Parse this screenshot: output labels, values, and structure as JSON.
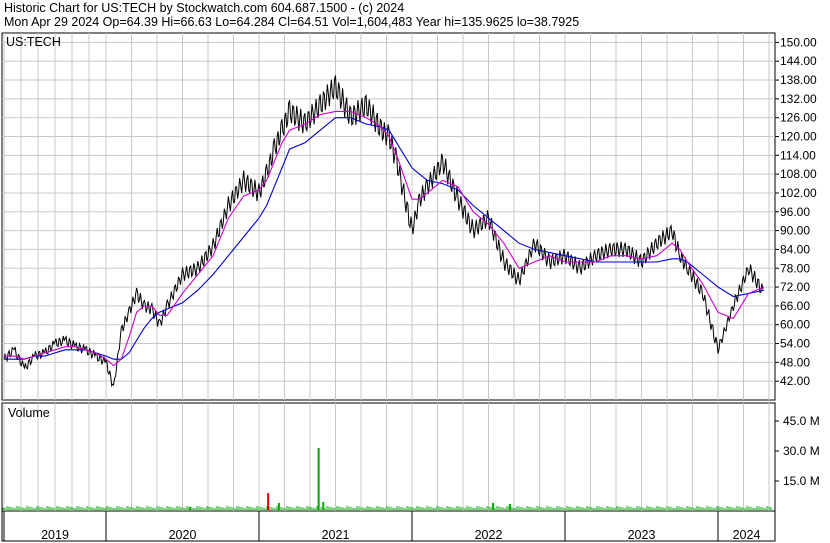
{
  "header": {
    "title_line": "Historic Chart for US:TECH by Stockwatch.com 604.687.1500 - (c) 2024",
    "stats_line": "Mon Apr 29 2024   Op=64.39   Hi=66.63   Lo=64.284   Cl=64.51   Vol=1,604,483   Year hi=135.9625   lo=38.7925"
  },
  "price_panel": {
    "symbol": "US:TECH"
  },
  "volume_panel": {
    "label": "Volume"
  },
  "colors": {
    "price": "#000000",
    "ma_short": "#cc00cc",
    "ma_long": "#0000cc",
    "vol_up": "#00aa00",
    "vol_down": "#dd0000",
    "grid": "#c8c8c8"
  },
  "chart_data": [
    {
      "type": "line",
      "title": "US:TECH",
      "ylim": [
        36,
        153
      ],
      "y_ticks": [
        "150.00",
        "144.00",
        "138.00",
        "132.00",
        "126.00",
        "120.00",
        "114.00",
        "108.00",
        "102.00",
        "96.00",
        "90.00",
        "84.00",
        "78.00",
        "72.00",
        "66.00",
        "60.00",
        "54.00",
        "48.00",
        "42.00"
      ],
      "x_ticks": [
        "2019",
        "2020",
        "2021",
        "2022",
        "2023",
        "2024"
      ],
      "x": [
        2019.0,
        2019.1,
        2019.2,
        2019.3,
        2019.4,
        2019.5,
        2019.6,
        2019.7,
        2019.8,
        2019.9,
        2020.0,
        2020.05,
        2020.1,
        2020.15,
        2020.2,
        2020.25,
        2020.3,
        2020.35,
        2020.4,
        2020.5,
        2020.6,
        2020.7,
        2020.8,
        2020.9,
        2021.0,
        2021.05,
        2021.1,
        2021.15,
        2021.2,
        2021.3,
        2021.4,
        2021.5,
        2021.6,
        2021.7,
        2021.8,
        2021.85,
        2021.9,
        2022.0,
        2022.05,
        2022.1,
        2022.2,
        2022.3,
        2022.4,
        2022.5,
        2022.6,
        2022.7,
        2022.8,
        2022.9,
        2023.0,
        2023.1,
        2023.2,
        2023.3,
        2023.4,
        2023.5,
        2023.6,
        2023.7,
        2023.75,
        2023.8,
        2023.9,
        2024.0,
        2024.1,
        2024.2,
        2024.3
      ],
      "series": [
        {
          "values": [
            49,
            52,
            46,
            50,
            51,
            54,
            55,
            53,
            52,
            50,
            48,
            40,
            58,
            64,
            70,
            66,
            65,
            60,
            66,
            76,
            78,
            85,
            98,
            106,
            102,
            108,
            116,
            122,
            128,
            124,
            130,
            136,
            126,
            130,
            122,
            120,
            112,
            90,
            100,
            104,
            112,
            100,
            90,
            94,
            80,
            74,
            86,
            80,
            82,
            78,
            82,
            84,
            84,
            80,
            86,
            90,
            82,
            78,
            70,
            52,
            66,
            78,
            70,
            72,
            72,
            66,
            62
          ]
        }
      ],
      "ma_short": [
        50,
        50,
        49,
        50,
        51,
        52,
        53,
        53,
        52,
        51,
        49,
        47,
        49,
        56,
        64,
        66,
        66,
        63,
        63,
        70,
        76,
        82,
        94,
        101,
        103,
        106,
        112,
        118,
        122,
        124,
        127,
        128,
        128,
        126,
        123,
        120,
        114,
        100,
        100,
        102,
        106,
        104,
        96,
        92,
        86,
        78,
        80,
        82,
        80,
        80,
        80,
        82,
        82,
        81,
        82,
        86,
        84,
        80,
        73,
        64,
        62,
        70,
        72,
        72,
        70,
        66,
        64
      ],
      "ma_long": [
        49,
        49,
        49,
        50,
        50,
        51,
        52,
        52,
        52,
        51,
        50,
        49,
        49,
        51,
        55,
        59,
        62,
        64,
        65,
        67,
        71,
        76,
        82,
        88,
        94,
        98,
        104,
        110,
        116,
        118,
        122,
        126,
        126,
        124,
        123,
        122,
        118,
        110,
        108,
        106,
        105,
        103,
        98,
        94,
        90,
        86,
        84,
        83,
        82,
        81,
        80,
        80,
        80,
        80,
        80,
        81,
        81,
        80,
        76,
        72,
        69,
        70,
        71,
        72,
        71,
        70,
        69
      ]
    },
    {
      "type": "bar",
      "title": "Volume",
      "y_ticks": [
        "45.0 M",
        "30.0 M",
        "15.0 M"
      ],
      "ylim": [
        0,
        54
      ],
      "spikes": [
        {
          "x": 2020.55,
          "value": 2.0,
          "color": "#00aa00"
        },
        {
          "x": 2021.06,
          "value": 9.0,
          "color": "#dd0000"
        },
        {
          "x": 2021.13,
          "value": 4.0,
          "color": "#00aa00"
        },
        {
          "x": 2021.39,
          "value": 31.5,
          "color": "#00aa00"
        },
        {
          "x": 2021.42,
          "value": 4.5,
          "color": "#00aa00"
        },
        {
          "x": 2022.53,
          "value": 4.0,
          "color": "#00aa00"
        },
        {
          "x": 2022.64,
          "value": 3.5,
          "color": "#00aa00"
        }
      ],
      "baseline": 1.5
    }
  ]
}
